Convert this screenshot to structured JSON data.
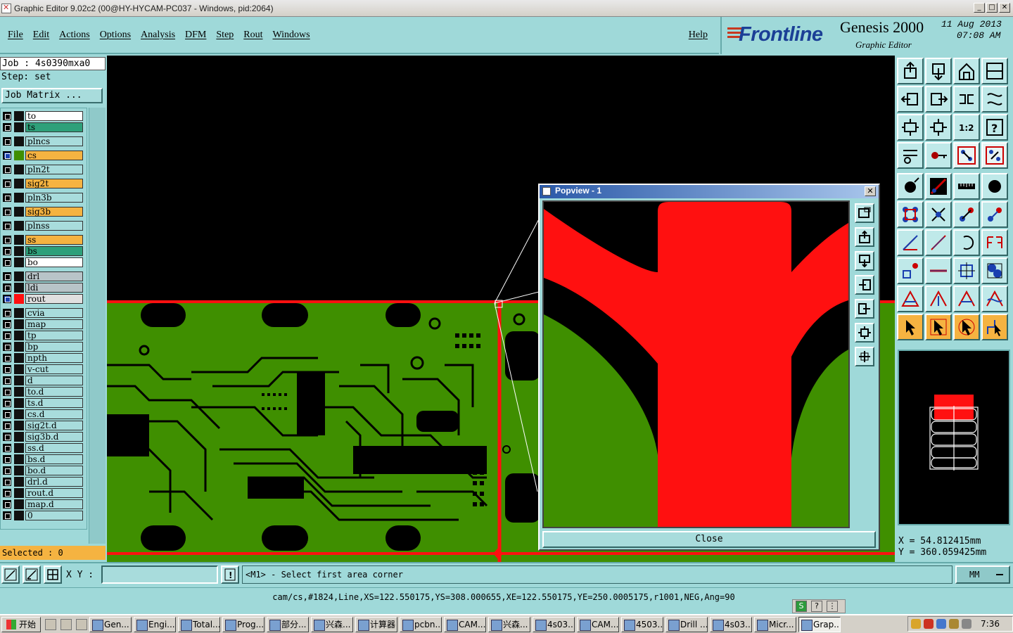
{
  "window": {
    "title": "Graphic Editor 9.02c2 (00@HY-HYCAM-PC037 - Windows, pid:2064)",
    "buttons": [
      "_",
      "□",
      "✕"
    ]
  },
  "menu": {
    "items": [
      "File",
      "Edit",
      "Actions",
      "Options",
      "Analysis",
      "DFM",
      "Step",
      "Rout",
      "Windows"
    ],
    "help": "Help"
  },
  "brand": {
    "logo": "Frontline",
    "product": "Genesis 2000",
    "subtitle": "Graphic Editor",
    "date": "11 Aug 2013",
    "time": "07:08 AM"
  },
  "job": {
    "job_line": "Job : 4s0390mxa0",
    "step_line": "Step: set",
    "matrix_button": "Job Matrix ..."
  },
  "layers": [
    {
      "name": "to",
      "color": "#ffffff",
      "checked": false
    },
    {
      "name": "ts",
      "color": "#2ea07a",
      "checked": false
    },
    {
      "name": "plncs",
      "color": "#a8dcdc",
      "checked": false
    },
    {
      "name": "cs",
      "color": "#f5b341",
      "checked": true,
      "active": true
    },
    {
      "name": "pln2t",
      "color": "#a8dcdc",
      "checked": false
    },
    {
      "name": "sig2t",
      "color": "#f5b341",
      "checked": false
    },
    {
      "name": "pln3b",
      "color": "#a8dcdc",
      "checked": false
    },
    {
      "name": "sig3b",
      "color": "#f5b341",
      "checked": false
    },
    {
      "name": "plnss",
      "color": "#a8dcdc",
      "checked": false
    },
    {
      "name": "ss",
      "color": "#f5b341",
      "checked": false
    },
    {
      "name": "bs",
      "color": "#2ea07a",
      "checked": false
    },
    {
      "name": "bo",
      "color": "#ffffff",
      "checked": false
    },
    {
      "name": "drl",
      "color": "#b8c4c8",
      "checked": false
    },
    {
      "name": "ldi",
      "color": "#b8c4c8",
      "checked": false
    },
    {
      "name": "rout",
      "color": "#e0e0e0",
      "checked": true,
      "swatch": "#ff1010"
    },
    {
      "name": "cvia",
      "color": "#a8dcdc",
      "checked": false
    },
    {
      "name": "map",
      "color": "#a8dcdc",
      "checked": false
    },
    {
      "name": "tp",
      "color": "#a8dcdc",
      "checked": false
    },
    {
      "name": "bp",
      "color": "#a8dcdc",
      "checked": false
    },
    {
      "name": "npth",
      "color": "#a8dcdc",
      "checked": false
    },
    {
      "name": "v-cut",
      "color": "#a8dcdc",
      "checked": false
    },
    {
      "name": "d",
      "color": "#a8dcdc",
      "checked": false
    },
    {
      "name": "to.d",
      "color": "#a8dcdc",
      "checked": false
    },
    {
      "name": "ts.d",
      "color": "#a8dcdc",
      "checked": false
    },
    {
      "name": "cs.d",
      "color": "#a8dcdc",
      "checked": false
    },
    {
      "name": "sig2t.d",
      "color": "#a8dcdc",
      "checked": false
    },
    {
      "name": "sig3b.d",
      "color": "#a8dcdc",
      "checked": false
    },
    {
      "name": "ss.d",
      "color": "#a8dcdc",
      "checked": false
    },
    {
      "name": "bs.d",
      "color": "#a8dcdc",
      "checked": false
    },
    {
      "name": "bo.d",
      "color": "#a8dcdc",
      "checked": false
    },
    {
      "name": "drl.d",
      "color": "#a8dcdc",
      "checked": false
    },
    {
      "name": "rout.d",
      "color": "#a8dcdc",
      "checked": false
    },
    {
      "name": "map.d",
      "color": "#a8dcdc",
      "checked": false
    },
    {
      "name": "0",
      "color": "#a8dcdc",
      "checked": false
    }
  ],
  "selected": "Selected : 0",
  "popview": {
    "title": "Popview - 1",
    "close_label": "Close"
  },
  "coords": {
    "x": "X = 54.812415mm",
    "y": "Y = 360.059425mm"
  },
  "input": {
    "xy_label": "X Y :",
    "xy_value": "",
    "prompt": "<M1> - Select first area corner",
    "units": "MM"
  },
  "status": "cam/cs,#1824,Line,XS=122.550175,YS=308.000655,XE=122.550175,YE=250.0005175,r1001,NEG,Ang=90",
  "taskbar": {
    "start": "开始",
    "tasks": [
      "Gen...",
      "Engi...",
      "Total...",
      "Prog...",
      "部分...",
      "兴森...",
      "计算器",
      "pcbn...",
      "CAM...",
      "兴森...",
      "4s03...",
      "CAM...",
      "4503...",
      "Drill ...",
      "4s03...",
      "Micr...",
      "Grap..."
    ],
    "active_task": "Grap...",
    "clock": "7:36"
  },
  "colors": {
    "panel": "#9fd9d9",
    "board": "#3f8f00",
    "copper": "#ff1010",
    "accent_orange": "#f5b341"
  }
}
